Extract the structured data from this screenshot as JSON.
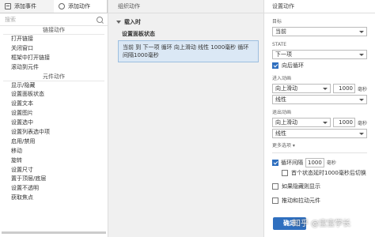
{
  "left_panel": {
    "tabs": [
      {
        "label": "添加事件",
        "icon": "event-icon"
      },
      {
        "label": "添加动作",
        "icon": "action-icon"
      }
    ],
    "search": {
      "placeholder": "搜索"
    },
    "sections": [
      {
        "title": "链接动作",
        "items": [
          "打开链接",
          "关闭窗口",
          "框架中打开链接",
          "滚动到元件"
        ]
      },
      {
        "title": "元件动作",
        "items": [
          "显示/隐藏",
          "设置面板状态",
          "设置文本",
          "设置图片",
          "设置选中",
          "设置列表选中项",
          "启用/禁用",
          "移动",
          "旋转",
          "设置尺寸",
          "置于顶层/底层",
          "设置不透明",
          "获取焦点"
        ]
      }
    ]
  },
  "middle_panel": {
    "title": "组织动作",
    "event": "载入时",
    "case_label": "设置面板状态",
    "action_text": "当前 到 下一项 循环 向上滑动 线性 1000毫秒 循环间隔1000毫秒"
  },
  "right_panel": {
    "title": "设置动作",
    "target_label": "目标",
    "target_value": "当前",
    "state_label": "STATE",
    "state_value": "下一项",
    "loop_back_label": "向后循环",
    "enter_anim_label": "进入动画",
    "enter_anim_value": "向上滑动",
    "enter_duration": "1000",
    "enter_unit": "毫秒",
    "enter_easing": "线性",
    "exit_anim_label": "退出动画",
    "exit_anim_value": "向上滑动",
    "exit_duration": "1000",
    "exit_unit": "毫秒",
    "exit_easing": "线性",
    "more_options": "更多选项 ▾",
    "loop_interval_label": "循环间隔",
    "loop_interval_value": "1000",
    "loop_interval_unit": "毫秒",
    "first_state_delay": "首个状态延时1000毫秒后切换",
    "show_if_hidden": "如果隐藏则显示",
    "push_pull": "推动和拉动元件",
    "ok_button": "确定"
  },
  "watermark": "知乎 @宝宝学长",
  "colors": {
    "accent": "#2f6fbf",
    "selection": "#dbe8f5"
  }
}
